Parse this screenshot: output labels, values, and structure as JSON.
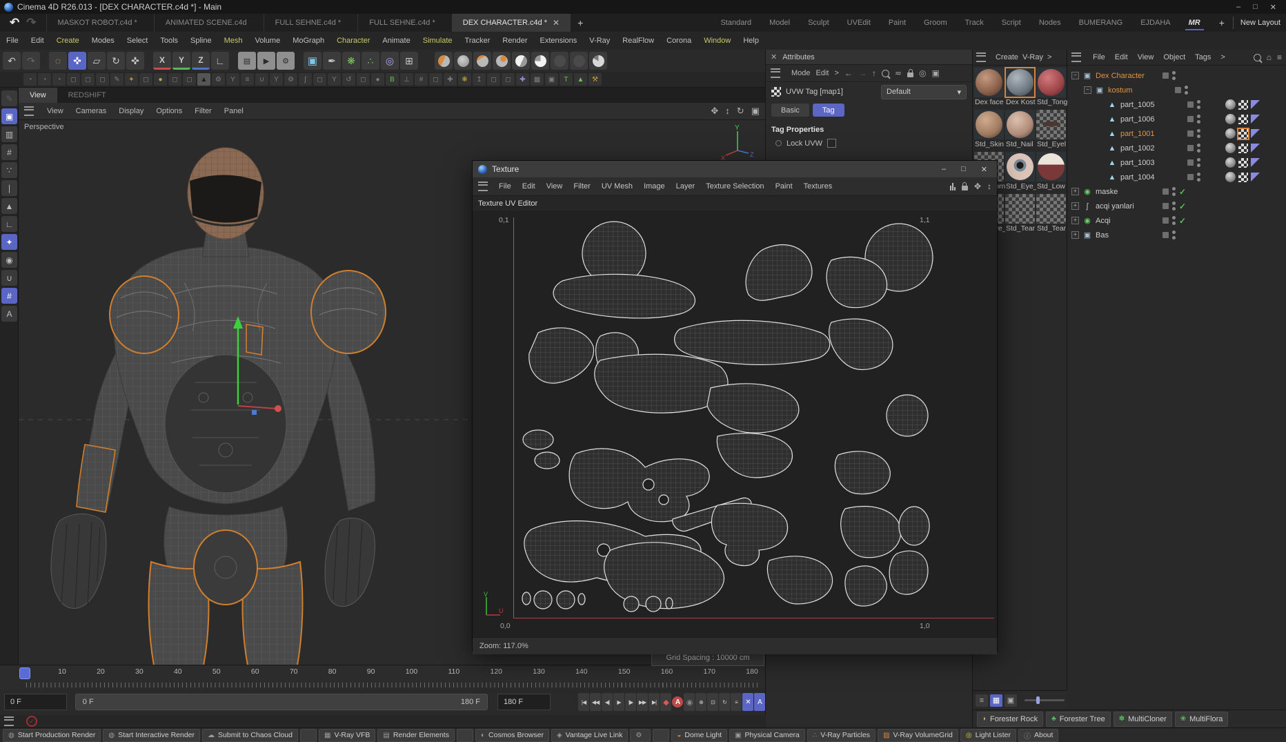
{
  "colors": {
    "accent": "#5a66c4",
    "selection_orange": "#d9863c",
    "check_green": "#55c055"
  },
  "window": {
    "title": "Cinema 4D R26.013 - [DEX CHARACTER.c4d *] - Main",
    "minimize": "–",
    "maximize": "□",
    "close": "✕"
  },
  "doc_tabs": {
    "add": "+",
    "items": [
      {
        "label": "MASKOT ROBOT.c4d *"
      },
      {
        "label": "ANIMATED SCENE.c4d"
      },
      {
        "label": "FULL SEHNE.c4d *"
      },
      {
        "label": "FULL SEHNE.c4d *"
      },
      {
        "label": "DEX CHARACTER.c4d *",
        "active": true,
        "close": "✕"
      }
    ]
  },
  "layout_tabs": {
    "add": "+",
    "new_layout": "New Layout",
    "items": [
      {
        "label": "Standard"
      },
      {
        "label": "Model"
      },
      {
        "label": "Sculpt"
      },
      {
        "label": "UVEdit"
      },
      {
        "label": "Paint"
      },
      {
        "label": "Groom"
      },
      {
        "label": "Track"
      },
      {
        "label": "Script"
      },
      {
        "label": "Nodes"
      },
      {
        "label": "BUMERANG"
      },
      {
        "label": "EJDAHA"
      },
      {
        "label": "MR",
        "active": true
      }
    ]
  },
  "menubar": {
    "items": [
      {
        "label": "File"
      },
      {
        "label": "Edit"
      },
      {
        "label": "Create",
        "hl": true
      },
      {
        "label": "Modes"
      },
      {
        "label": "Select"
      },
      {
        "label": "Tools"
      },
      {
        "label": "Spline"
      },
      {
        "label": "Mesh",
        "hl": true
      },
      {
        "label": "Volume"
      },
      {
        "label": "MoGraph"
      },
      {
        "label": "Character",
        "hl": true
      },
      {
        "label": "Animate"
      },
      {
        "label": "Simulate",
        "hl": true
      },
      {
        "label": "Tracker"
      },
      {
        "label": "Render"
      },
      {
        "label": "Extensions"
      },
      {
        "label": "V-Ray"
      },
      {
        "label": "RealFlow"
      },
      {
        "label": "Corona"
      },
      {
        "label": "Window",
        "hl": true
      },
      {
        "label": "Help"
      }
    ]
  },
  "main_toolbar": [
    {
      "g": "↶",
      "n": "undo-icon"
    },
    {
      "g": "↷",
      "n": "redo-icon",
      "cls": "dim"
    },
    {
      "sep": true
    },
    {
      "g": "◌",
      "n": "live-selection-icon",
      "cls": "dash"
    },
    {
      "g": "✜",
      "n": "move-tool-icon",
      "cls": "on"
    },
    {
      "g": "▱",
      "n": "scale-tool-icon"
    },
    {
      "g": "↻",
      "n": "rotate-tool-icon"
    },
    {
      "g": "✜",
      "n": "omni-move-icon"
    },
    {
      "sep": true
    },
    {
      "g": "X",
      "n": "x-axis-lock",
      "cls": "ax axx"
    },
    {
      "g": "Y",
      "n": "y-axis-lock",
      "cls": "ax axy"
    },
    {
      "g": "Z",
      "n": "z-axis-lock",
      "cls": "ax axz"
    },
    {
      "g": "∟",
      "n": "coord-system-icon"
    },
    {
      "sep": true
    },
    {
      "g": "▤",
      "n": "render-view-icon",
      "cls": "clap"
    },
    {
      "g": "▶",
      "n": "render-picture-viewer-icon",
      "cls": "clap"
    },
    {
      "g": "⚙",
      "n": "render-settings-icon",
      "cls": "clap"
    },
    {
      "sep": true
    },
    {
      "g": "▣",
      "n": "add-cube-icon",
      "cls": "cube"
    },
    {
      "g": "✒",
      "n": "spline-pen-icon"
    },
    {
      "g": "❋",
      "n": "mograph-icon",
      "cls": "green"
    },
    {
      "g": "∴",
      "n": "effector-icon",
      "cls": "green"
    },
    {
      "g": "◎",
      "n": "volume-icon",
      "cls": "purple"
    },
    {
      "g": "⊞",
      "n": "field-icon"
    },
    {
      "sep": true
    },
    {
      "sep": true
    },
    {
      "n": "sim-ball-1-icon",
      "cls": "ball b1"
    },
    {
      "n": "sim-ball-2-icon",
      "cls": "ball b2"
    },
    {
      "n": "sim-ball-3-icon",
      "cls": "ball b3"
    },
    {
      "n": "sim-ball-4-icon",
      "cls": "ball b4"
    },
    {
      "n": "sim-ball-5-icon",
      "cls": "ball b5"
    },
    {
      "n": "sim-ball-6-icon",
      "cls": "ball b6"
    },
    {
      "n": "sim-ball-7-icon",
      "cls": "ball b7"
    },
    {
      "n": "sim-ball-8-icon",
      "cls": "ball b8"
    },
    {
      "n": "sim-ball-9-icon",
      "cls": "ball b9"
    }
  ],
  "toolbar2": [
    {
      "g": "◔"
    },
    {
      "g": "◔"
    },
    {
      "g": "◔"
    },
    {
      "g": "◻"
    },
    {
      "g": "◻"
    },
    {
      "g": "◻"
    },
    {
      "g": "✎"
    },
    {
      "g": "✦",
      "c": "orange"
    },
    {
      "g": "◻"
    },
    {
      "g": "●",
      "c": "olive"
    },
    {
      "g": "◻"
    },
    {
      "g": "◻"
    },
    {
      "g": "▲",
      "c": "dark"
    },
    {
      "g": "⚙"
    },
    {
      "g": "Y"
    },
    {
      "g": "≡"
    },
    {
      "g": "∪"
    },
    {
      "g": "Y"
    },
    {
      "g": "⚙"
    },
    {
      "g": "ʃ"
    },
    {
      "g": "◻"
    },
    {
      "g": "Y"
    },
    {
      "g": "↺"
    },
    {
      "g": "◻"
    },
    {
      "g": "●"
    },
    {
      "g": "B",
      "c": "green"
    },
    {
      "g": "⊥"
    },
    {
      "g": "#"
    },
    {
      "g": "◻"
    },
    {
      "g": "✚"
    },
    {
      "g": "❋",
      "c": "gold"
    },
    {
      "g": "↥"
    },
    {
      "g": "◻"
    },
    {
      "g": "◻"
    },
    {
      "g": "✚",
      "c": "purple"
    },
    {
      "g": "▦"
    },
    {
      "g": "▣"
    },
    {
      "g": "T",
      "c": "green"
    },
    {
      "g": "▲",
      "c": "green"
    },
    {
      "g": "⚒",
      "c": "gold"
    }
  ],
  "palette": [
    {
      "g": "✎",
      "n": "tweak-mode-icon",
      "cls": "dim"
    },
    {
      "g": "▣",
      "n": "model-mode-icon",
      "cls": "on"
    },
    {
      "g": "▥",
      "n": "texture-mode-icon"
    },
    {
      "g": "#",
      "n": "workplane-mode-icon"
    },
    {
      "g": "∵",
      "n": "points-mode-icon"
    },
    {
      "g": "∣",
      "n": "edges-mode-icon"
    },
    {
      "g": "▲",
      "n": "polygons-mode-icon"
    },
    {
      "g": "∟",
      "n": "axis-mode-icon"
    },
    {
      "g": "✦",
      "n": "enable-snap-icon",
      "cls": "on"
    },
    {
      "g": "◉",
      "n": "viewport-solo-icon"
    },
    {
      "g": "∪",
      "n": "magnet-icon"
    },
    {
      "g": "#",
      "n": "lock-workplane-icon",
      "cls": "on"
    },
    {
      "g": "A",
      "n": "auto-workplane-icon"
    }
  ],
  "viewport": {
    "tabs": [
      {
        "label": "View",
        "active": true
      },
      {
        "label": "REDSHIFT"
      }
    ],
    "menus": [
      {
        "label": "View"
      },
      {
        "label": "Cameras"
      },
      {
        "label": "Display"
      },
      {
        "label": "Options"
      },
      {
        "label": "Filter"
      },
      {
        "label": "Panel"
      }
    ],
    "projection": "Perspective",
    "axis_label": "Y",
    "grid_spacing": "Grid Spacing : 10000 cm"
  },
  "attributes": {
    "close": "✕",
    "title": "Attributes",
    "mode": "Mode",
    "edit": "Edit",
    "more": ">",
    "tag_label": "UVW Tag [map1]",
    "preset": "Default",
    "preset_arrow": "▾",
    "tabs": [
      {
        "label": "Basic"
      },
      {
        "label": "Tag",
        "active": true
      }
    ],
    "section": "Tag Properties",
    "property": "Lock UVW"
  },
  "materials": {
    "create": "Create",
    "vray": "V-Ray",
    "more": ">",
    "items": [
      {
        "name": "Dex face",
        "tcls": "m-face"
      },
      {
        "name": "Dex Kost",
        "tcls": "m-rock",
        "sel": true
      },
      {
        "name": "Std_Tong",
        "tcls": "m-red"
      },
      {
        "name": "Std_Skin",
        "tcls": "m-skin"
      },
      {
        "name": "Std_Nail",
        "tcls": "m-nail"
      },
      {
        "name": "Std_Eyel",
        "tcls": "m-checker m-lash"
      },
      {
        "name": "Std_Corn",
        "tcls": "m-checker"
      },
      {
        "name": "Std_Eye_",
        "tcls": "m-eye"
      },
      {
        "name": "Std_Low",
        "tcls": "m-eyehalf"
      },
      {
        "name": "Std_Eye_",
        "tcls": "m-checker"
      },
      {
        "name": "Std_Tear",
        "tcls": "m-checker"
      },
      {
        "name": "Std_Tear",
        "tcls": "m-checker"
      }
    ],
    "footer_icons": [
      "≡",
      "▦",
      "▣"
    ]
  },
  "object_manager": {
    "menus": [
      {
        "label": "File"
      },
      {
        "label": "Edit"
      },
      {
        "label": "View"
      },
      {
        "label": "Object"
      },
      {
        "label": "Tags"
      },
      {
        "label": ">"
      }
    ],
    "home_icon": "⌂",
    "filter_icon": "≡",
    "tree": [
      {
        "name": "Dex Character",
        "ex": "−",
        "icon": "▣",
        "icls": "ic-null",
        "ncls": "orange"
      },
      {
        "name": "kostum",
        "ex": "−",
        "icon": "▣",
        "icls": "ic-null",
        "ncls": "orange",
        "ind": "d1"
      },
      {
        "name": "part_1005",
        "icon": "▲",
        "icls": "ic-poly",
        "ind": "d2",
        "leaf": true,
        "tags": true
      },
      {
        "name": "part_1006",
        "icon": "▲",
        "icls": "ic-poly",
        "ind": "d2",
        "leaf": true,
        "tags": true
      },
      {
        "name": "part_1001",
        "icon": "▲",
        "icls": "ic-poly",
        "ind": "d2",
        "leaf": true,
        "tags": true,
        "ncls": "orange",
        "tagsel": true
      },
      {
        "name": "part_1002",
        "icon": "▲",
        "icls": "ic-poly",
        "ind": "d2",
        "leaf": true,
        "tags": true
      },
      {
        "name": "part_1003",
        "icon": "▲",
        "icls": "ic-poly",
        "ind": "d2",
        "leaf": true,
        "tags": true
      },
      {
        "name": "part_1004",
        "icon": "▲",
        "icls": "ic-poly",
        "ind": "d2",
        "leaf": true,
        "tags": true
      },
      {
        "name": "maske",
        "ex": "+",
        "icon": "◉",
        "icls": "ic-gen",
        "check": true
      },
      {
        "name": "acqi yanlari",
        "ex": "+",
        "icon": "ʃ",
        "icls": "ic-spline",
        "check": true
      },
      {
        "name": "Acqi",
        "ex": "+",
        "icon": "◉",
        "icls": "ic-gen",
        "check": true
      },
      {
        "name": "Bas",
        "ex": "+",
        "icon": "▣",
        "icls": "ic-null"
      }
    ]
  },
  "texture_window": {
    "title": "Texture",
    "minimize": "–",
    "maximize": "□",
    "close": "✕",
    "menus": [
      {
        "label": "File"
      },
      {
        "label": "Edit"
      },
      {
        "label": "View"
      },
      {
        "label": "Filter"
      },
      {
        "label": "UV Mesh"
      },
      {
        "label": "Image"
      },
      {
        "label": "Layer"
      },
      {
        "label": "Texture Selection"
      },
      {
        "label": "Paint"
      },
      {
        "label": "Textures"
      }
    ],
    "editor_label": "Texture UV Editor",
    "corner_tl": "0,1",
    "corner_tr": "1,1",
    "corner_bl": "0,0",
    "corner_br": "1,0",
    "axis_v": "V",
    "axis_u": "U",
    "zoom": "Zoom: 117.0%"
  },
  "timeline": {
    "ticks": [
      {
        "label": "0"
      },
      {
        "label": "10"
      },
      {
        "label": "20"
      },
      {
        "label": "30"
      },
      {
        "label": "40"
      },
      {
        "label": "50"
      },
      {
        "label": "60"
      },
      {
        "label": "70"
      },
      {
        "label": "80"
      },
      {
        "label": "90"
      },
      {
        "label": "100"
      },
      {
        "label": "110"
      },
      {
        "label": "120"
      },
      {
        "label": "130"
      },
      {
        "label": "140"
      },
      {
        "label": "150"
      },
      {
        "label": "160"
      },
      {
        "label": "170"
      },
      {
        "label": "180"
      }
    ],
    "current": "0 F",
    "range_start": "0 F",
    "range_end": "180 F",
    "end_field": "180 F",
    "buttons": [
      {
        "g": "|◀",
        "n": "goto-start-button"
      },
      {
        "g": "◀◀",
        "n": "prev-key-button"
      },
      {
        "g": "◀|",
        "n": "prev-frame-button"
      },
      {
        "g": "▶",
        "n": "play-button"
      },
      {
        "g": "|▶",
        "n": "next-frame-button"
      },
      {
        "g": "▶▶",
        "n": "next-key-button"
      },
      {
        "g": "▶|",
        "n": "goto-end-button"
      },
      {
        "g": "◆",
        "n": "record-keyframe-button",
        "cls": "rec"
      },
      {
        "g": "A",
        "n": "autokey-button",
        "cls": "reca"
      },
      {
        "g": "◉",
        "n": "keyframe-selection-button",
        "cls": "ring"
      },
      {
        "g": "⊕",
        "n": "key-position-toggle"
      },
      {
        "g": "⊡",
        "n": "key-scale-toggle"
      },
      {
        "g": "↻",
        "n": "key-rotation-toggle"
      },
      {
        "g": "≡",
        "n": "key-parameter-toggle"
      },
      {
        "g": "✕",
        "n": "key-pla-toggle",
        "cls": "blue"
      },
      {
        "g": "A",
        "n": "autokey-objects-toggle",
        "cls": "blue"
      }
    ]
  },
  "shelves": {
    "vray": [
      {
        "label": "Start Production Render",
        "g": "◍"
      },
      {
        "label": "Start Interactive Render",
        "g": "◍"
      },
      {
        "label": "Submit to Chaos Cloud",
        "g": "☁"
      },
      {
        "gap": true
      },
      {
        "label": "V-Ray VFB",
        "g": "▦"
      },
      {
        "label": "Render Elements",
        "g": "▤"
      },
      {
        "gap": true
      },
      {
        "label": "Cosmos Browser",
        "g": "◐"
      },
      {
        "label": "Vantage Live Link",
        "g": "◈"
      },
      {
        "label": "",
        "g": "⚙"
      },
      {
        "gap": true
      },
      {
        "label": "Dome Light",
        "g": "◒",
        "c": "orange"
      },
      {
        "label": "Physical Camera",
        "g": "▣"
      },
      {
        "label": "V-Ray Particles",
        "g": "∴"
      },
      {
        "label": "V-Ray VolumeGrid",
        "g": "▨",
        "c": "orange"
      },
      {
        "label": "Light Lister",
        "g": "◎",
        "c": "yellow"
      },
      {
        "label": "About",
        "g": "ⓘ"
      }
    ],
    "forester": [
      {
        "label": "Forester Rock",
        "g": "◗",
        "c": "tan"
      },
      {
        "label": "Forester Tree",
        "g": "♣",
        "c": "green"
      },
      {
        "label": "MultiCloner",
        "g": "✽",
        "c": "green"
      },
      {
        "label": "MultiFlora",
        "g": "❀",
        "c": "green"
      }
    ]
  }
}
